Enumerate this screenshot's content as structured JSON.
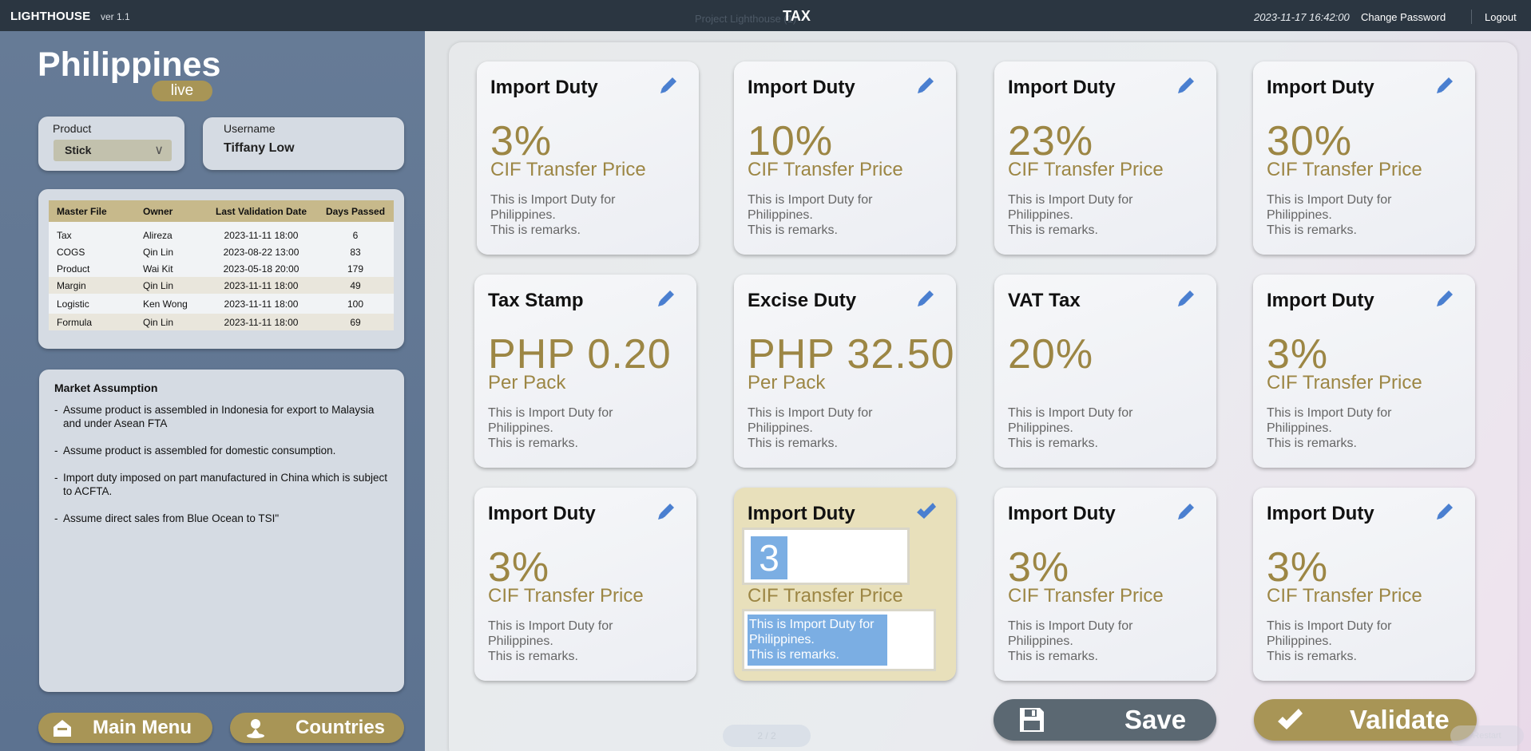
{
  "topbar": {
    "brand": "LIGHTHOUSE",
    "version": "ver 1.1",
    "faded_project": "Project Lighthouse (1)",
    "title": "TAX",
    "datetime": "2023-11-17 16:42:00",
    "change_password": "Change Password",
    "logout": "Logout"
  },
  "left": {
    "country": "Philippines",
    "status": "live",
    "product": {
      "label": "Product",
      "value": "Stick",
      "chevron": "∨"
    },
    "user": {
      "label": "Username",
      "value": "Tiffany Low"
    },
    "master": {
      "headers": [
        "Master File",
        "Owner",
        "Last Validation Date",
        "Days Passed"
      ],
      "rows": [
        [
          "Tax",
          "Alireza",
          "2023-11-11 18:00",
          "6"
        ],
        [
          "COGS",
          "Qin Lin",
          "2023-08-22 13:00",
          "83"
        ],
        [
          "Product",
          "Wai Kit",
          "2023-05-18 20:00",
          "179"
        ],
        [
          "Margin",
          "Qin Lin",
          "2023-11-11 18:00",
          "49"
        ],
        [
          "Logistic",
          "Ken Wong",
          "2023-11-11 18:00",
          "100"
        ],
        [
          "Formula",
          "Qin Lin",
          "2023-11-11 18:00",
          "69"
        ]
      ]
    },
    "assumption": {
      "title": "Market Assumption",
      "items": [
        "Assume product is assembled in Indonesia for export to Malaysia and under Asean FTA",
        "Assume product is assembled for domestic consumption.",
        "Import duty imposed on part manufactured in China which is subject to ACFTA.",
        "Assume direct sales from Blue Ocean to TSI\""
      ]
    },
    "nav": {
      "main_menu": "Main Menu",
      "countries": "Countries"
    }
  },
  "cards": [
    {
      "title": "Import Duty",
      "value": "3%",
      "unit": "CIF Transfer Price",
      "desc": [
        "This is Import Duty for",
        "Philippines.",
        "This is remarks."
      ]
    },
    {
      "title": "Import Duty",
      "value": "10%",
      "unit": "CIF Transfer Price",
      "desc": [
        "This is Import Duty for",
        "Philippines.",
        "This is remarks."
      ]
    },
    {
      "title": "Import Duty",
      "value": "23%",
      "unit": "CIF Transfer Price",
      "desc": [
        "This is Import Duty for",
        "Philippines.",
        "This is remarks."
      ]
    },
    {
      "title": "Import Duty",
      "value": "30%",
      "unit": "CIF Transfer Price",
      "desc": [
        "This is Import Duty for",
        "Philippines.",
        "This is remarks."
      ]
    },
    {
      "title": "Tax Stamp",
      "value": "PHP 0.20",
      "unit": "Per Pack",
      "desc": [
        "This is Import Duty for",
        "Philippines.",
        "This is remarks."
      ]
    },
    {
      "title": "Excise Duty",
      "value": "PHP 32.50",
      "unit": "Per Pack",
      "desc": [
        "This is Import Duty for",
        "Philippines.",
        "This is remarks."
      ]
    },
    {
      "title": "VAT Tax",
      "value": "20%",
      "unit": "",
      "desc": [
        "This is Import Duty for",
        "Philippines.",
        "This is remarks."
      ]
    },
    {
      "title": "Import Duty",
      "value": "3%",
      "unit": "CIF Transfer Price",
      "desc": [
        "This is Import Duty for",
        "Philippines.",
        "This is remarks."
      ]
    },
    {
      "title": "Import Duty",
      "value": "3%",
      "unit": "CIF Transfer Price",
      "desc": [
        "This is Import Duty for",
        "Philippines.",
        "This is remarks."
      ]
    },
    {
      "title": "Import Duty",
      "value": "3",
      "unit": "CIF Transfer Price",
      "desc": [
        "This is Import Duty for",
        "Philippines.",
        "This is remarks."
      ],
      "editing": true
    },
    {
      "title": "Import Duty",
      "value": "3%",
      "unit": "CIF Transfer Price",
      "desc": [
        "This is Import Duty for",
        "Philippines.",
        "This is remarks."
      ]
    },
    {
      "title": "Import Duty",
      "value": "3%",
      "unit": "CIF Transfer Price",
      "desc": [
        "This is Import Duty for",
        "Philippines.",
        "This is remarks."
      ]
    }
  ],
  "actions": {
    "save": "Save",
    "validate": "Validate"
  },
  "pager": "2 / 2",
  "restart": "Restart",
  "colors": {
    "accent_gold": "#a89556",
    "value_gold": "#9c8644",
    "edit_blue": "#4a7fd0",
    "save_grey": "#5b6872",
    "topbar": "#2b3641"
  },
  "icons": {
    "edit": "pencil-icon",
    "confirm": "checkmark-icon",
    "save": "floppy-disk-icon",
    "validate": "checkmark-icon",
    "main_menu": "home-icon",
    "countries": "location-pin-icon"
  }
}
